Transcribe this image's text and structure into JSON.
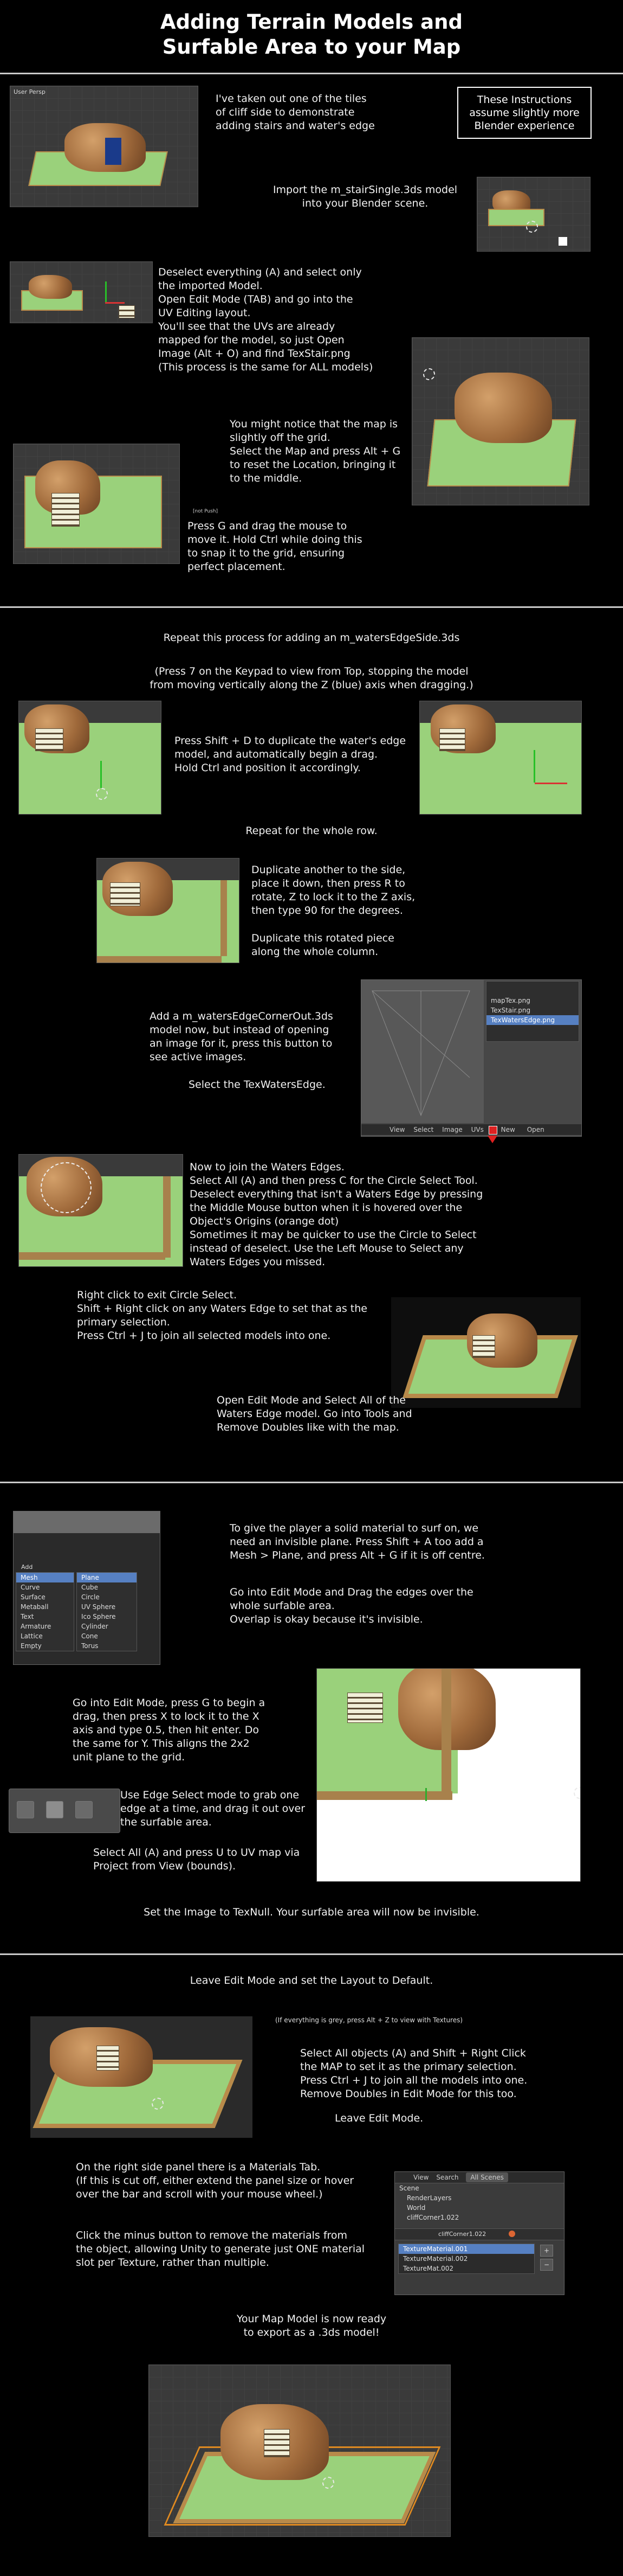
{
  "title_line1": "Adding Terrain Models and",
  "title_line2": "Surfable Area to your Map",
  "note": "These Instructions\nassume slightly more\nBlender experience",
  "sec1": {
    "viewport_label": "User Persp",
    "intro": "I've taken out one of the tiles\nof cliff side to demonstrate\nadding stairs and water's edge",
    "import": "Import the m_stairSingle.3ds model\ninto your Blender scene.",
    "deselect": "Deselect everything (A) and select only\nthe imported Model.\nOpen Edit Mode (TAB) and go into the\nUV Editing layout.\nYou'll see that the UVs are already\nmapped for the model, so just Open\nImage (Alt + O) and find TexStair.png\n    (This process is the same for ALL models)",
    "grid": "You might notice that the map is\nslightly off the grid.\nSelect the Map and press Alt + G\nto reset the Location, bringing it\nto the middle.",
    "pressg": "Press G and drag the mouse to\nmove it. Hold Ctrl while doing this\nto snap it to the grid, ensuring\nperfect placement.",
    "small_label": "[not Push]"
  },
  "sec2": {
    "repeat": "Repeat this process for adding an m_watersEdgeSide.3ds",
    "press7": "(Press 7 on the Keypad to view from Top, stopping the model\nfrom moving vertically along the Z (blue) axis when dragging.)",
    "shiftd": "Press Shift + D to duplicate the water's edge\nmodel, and automatically begin a drag.\nHold Ctrl and position it accordingly.",
    "row": "Repeat for the whole row.",
    "rotate": "Duplicate another to the side,\nplace it down, then press R to\nrotate, Z to lock it to the Z axis,\nthen type 90 for the degrees.",
    "column": "Duplicate this rotated piece\nalong the whole column.",
    "corner": "Add a m_watersEdgeCornerOut.3ds\nmodel now, but instead of opening\nan image for it, press this button to\nsee active images.",
    "select_tex": "Select the TexWatersEdge.",
    "image_list": [
      "mapTex.png",
      "TexStair.png",
      "TexWatersEdge.png"
    ],
    "image_header": [
      "View",
      "Select",
      "Image",
      "UVs",
      "New",
      "Open"
    ],
    "join": "Now to join the Waters Edges.\nSelect All (A) and then press C for the Circle Select Tool.\nDeselect everything that isn't a Waters Edge by pressing\nthe Middle Mouse button when it is hovered over the\nObject's Origins (orange dot)\nSometimes it may be quicker to use the Circle to Select\ninstead of deselect. Use the Left Mouse to Select any\nWaters Edges you missed.",
    "rightclick": "Right click to exit Circle Select.\nShift + Right click on any Waters Edge to set that as the\nprimary selection.\nPress Ctrl + J to join all selected models into one.",
    "doubles": "Open Edit Mode and Select All of the\nWaters Edge model. Go into Tools and\nRemove Doubles like with the map."
  },
  "sec3": {
    "plane": "To give the player a solid material to surf on, we\nneed an invisible plane. Press Shift + A too add a\nMesh > Plane, and press Alt + G if it is off centre.",
    "editdrag": "Go into Edit Mode and Drag the edges over the\nwhole surfable area.\nOverlap is okay because it's invisible.",
    "scale": "Go into Edit Mode, press G to begin a\ndrag, then press X to lock it to the X\naxis and type 0.5, then hit enter. Do\nthe same for Y. This aligns the 2x2\nunit plane to the grid.",
    "edgesel": "Use Edge Select mode to grab one\nedge at a time, and drag it out over\nthe surfable area.",
    "uvmap": "Select All (A) and press U to UV map via\nProject from View (bounds).",
    "texnull": "Set the Image to TexNull.   Your surfable area will now be invisible.",
    "add_menu_title": "Add",
    "add_menu": [
      "Mesh",
      "Curve",
      "Surface",
      "Metaball",
      "Text",
      "Armature",
      "Lattice",
      "Empty"
    ],
    "mesh_menu": [
      "Plane",
      "Cube",
      "Circle",
      "UV Sphere",
      "Ico Sphere",
      "Cylinder",
      "Cone",
      "Torus"
    ]
  },
  "sec4": {
    "leave": "Leave Edit Mode and set the Layout to Default.",
    "grey": "(If everything is grey, press Alt + Z to view with Textures)",
    "selectall": "Select All objects (A) and Shift + Right Click\nthe MAP to set it as the primary selection.\nPress Ctrl + J to join all the models into one.\nRemove Doubles in Edit Mode for this too.",
    "leave2": "Leave Edit Mode.",
    "materials": "On the right side panel there is a Materials Tab.\n  (If this is cut off, either extend the panel size or hover\n  over the bar and scroll with your mouse wheel.)",
    "minus": "Click the minus button to remove the materials from\nthe object, allowing Unity to generate just ONE material\nslot per Texture, rather than multiple.",
    "ready": "Your Map Model is now ready\nto export as a .3ds model!",
    "outliner_header": [
      "View",
      "Search",
      "All Scenes"
    ],
    "outliner": [
      "Scene",
      "RenderLayers",
      "World",
      "cliffCorner1.022"
    ],
    "materials_list": [
      "TextureMaterial.001",
      "TextureMaterial.002",
      "TextureMat.002"
    ],
    "material_top": "cliffCorner1.022"
  }
}
